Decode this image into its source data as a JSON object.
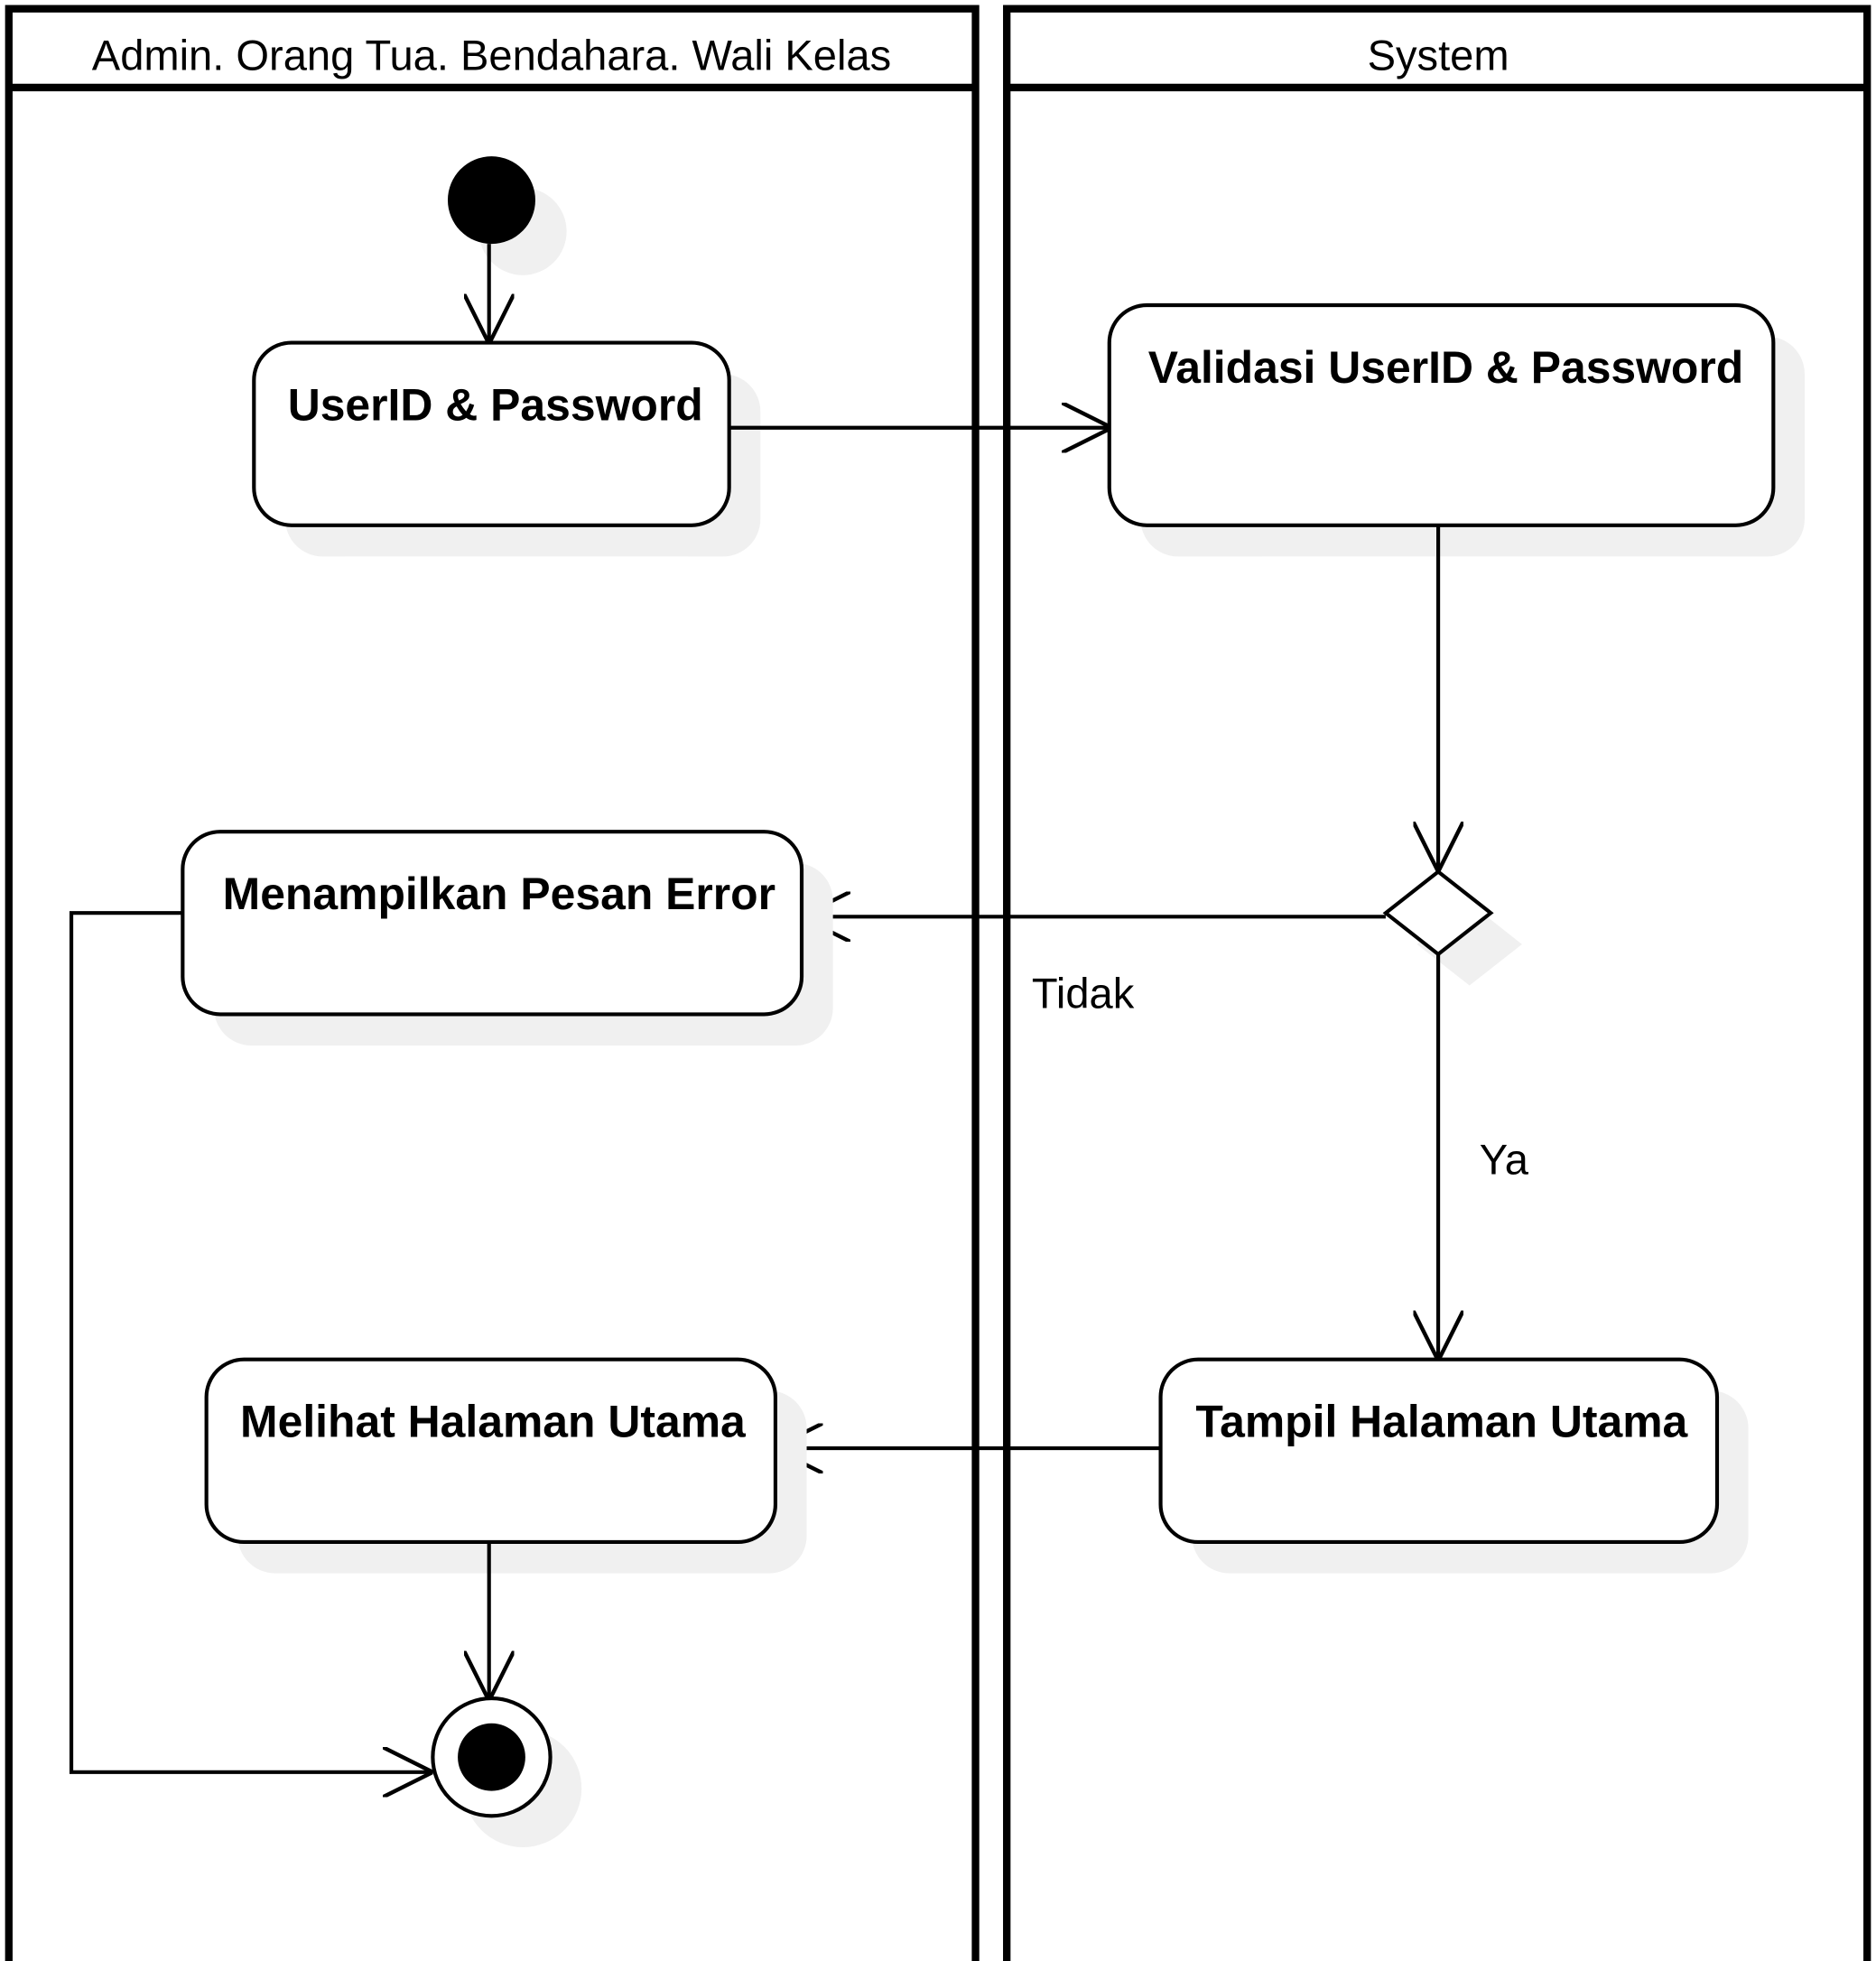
{
  "swimlanes": [
    {
      "title": "Admin. Orang Tua. Bendahara. Wali Kelas"
    },
    {
      "title": "System"
    }
  ],
  "activities": {
    "userid_password": "UserID & Password",
    "validasi": "Validasi UserID & Password",
    "pesan_error": "Menampilkan Pesan Error",
    "tampil_halaman": "Tampil Halaman Utama",
    "melihat_halaman": "Melihat Halaman Utama"
  },
  "guards": {
    "no": "Tidak",
    "yes": "Ya"
  }
}
